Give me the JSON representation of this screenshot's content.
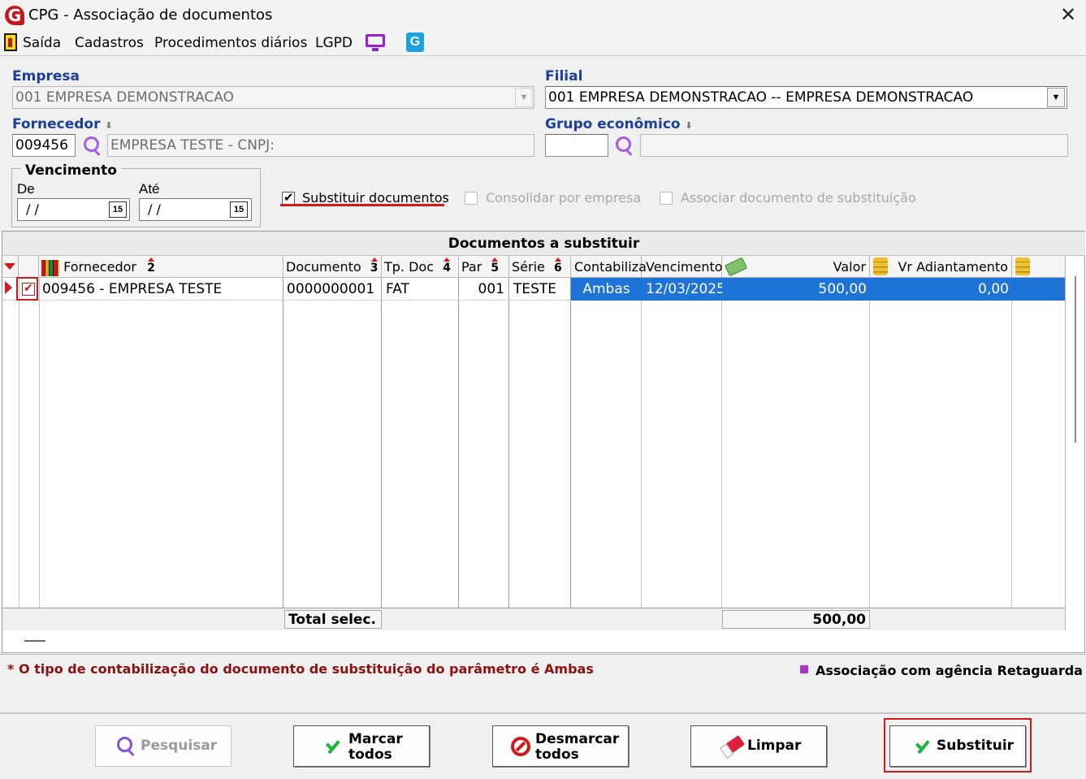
{
  "window": {
    "title": "CPG - Associação de documentos",
    "close_glyph": "✕",
    "app_icon_letter": "G"
  },
  "menu": {
    "items": [
      "Saída",
      "Cadastros",
      "Procedimentos diários",
      "LGPD"
    ],
    "g_icon_letter": "G"
  },
  "form": {
    "empresa": {
      "label": "Empresa",
      "value": "001 EMPRESA DEMONSTRACAO",
      "enabled": false
    },
    "filial": {
      "label": "Filial",
      "value": "001 EMPRESA DEMONSTRACAO -- EMPRESA DEMONSTRACAO"
    },
    "fornecedor": {
      "label": "Fornecedor",
      "code": "009456",
      "description": "EMPRESA TESTE - CNPJ:"
    },
    "grupo_economico": {
      "label": "Grupo econômico",
      "code": "",
      "description": ""
    },
    "vencimento": {
      "title": "Vencimento",
      "de_label": "De",
      "de_value": "/ /",
      "ate_label": "Até",
      "ate_value": "/ /",
      "calendar_text": "15"
    },
    "checkboxes": {
      "substituir": {
        "label": "Substituir documentos",
        "checked": true
      },
      "consolidar": {
        "label": "Consolidar por empresa",
        "checked": false,
        "enabled": false
      },
      "associar": {
        "label": "Associar documento de substituição",
        "checked": false,
        "enabled": false
      }
    }
  },
  "grid": {
    "caption": "Documentos a substituir",
    "columns": {
      "fornecedor": {
        "label": "Fornecedor",
        "sort": "2"
      },
      "documento": {
        "label": "Documento",
        "sort": "3"
      },
      "tp_doc": {
        "label": "Tp. Doc",
        "sort": "4"
      },
      "par": {
        "label": "Par",
        "sort": "5"
      },
      "serie": {
        "label": "Série",
        "sort": "6"
      },
      "contabiliza": {
        "label": "Contabiliza"
      },
      "vencimento": {
        "label": "Vencimento"
      },
      "valor": {
        "label": "Valor"
      },
      "vr_adiantamento": {
        "label": "Vr Adiantamento"
      }
    },
    "rows": [
      {
        "selected": true,
        "fornecedor": "009456 - EMPRESA TESTE",
        "documento": "0000000001",
        "tp_doc": "FAT",
        "par": "001",
        "serie": "TESTE",
        "contabiliza": "Ambas",
        "vencimento": "12/03/2025",
        "valor": "500,00",
        "vr_adiantamento": "0,00"
      }
    ],
    "total_label": "Total selec.",
    "total_valor": "500,00"
  },
  "footer": {
    "note": "* O tipo de contabilização do documento de substituição do parâmetro é Ambas",
    "legend": {
      "label": "Associação com agência Retaguarda",
      "color": "#a43ac8"
    }
  },
  "buttons": {
    "pesquisar": {
      "label": "Pesquisar",
      "enabled": false
    },
    "marcar": {
      "line1": "Marcar",
      "line2": "todos"
    },
    "desmarcar": {
      "line1": "Desmarcar",
      "line2": "todos"
    },
    "limpar": {
      "label": "Limpar"
    },
    "substituir": {
      "label": "Substituir"
    }
  },
  "colors": {
    "label_blue": "#1b3f9e",
    "selection_blue": "#1d73d6",
    "highlight_red": "#d11a1a",
    "note_red": "#8e1010"
  }
}
